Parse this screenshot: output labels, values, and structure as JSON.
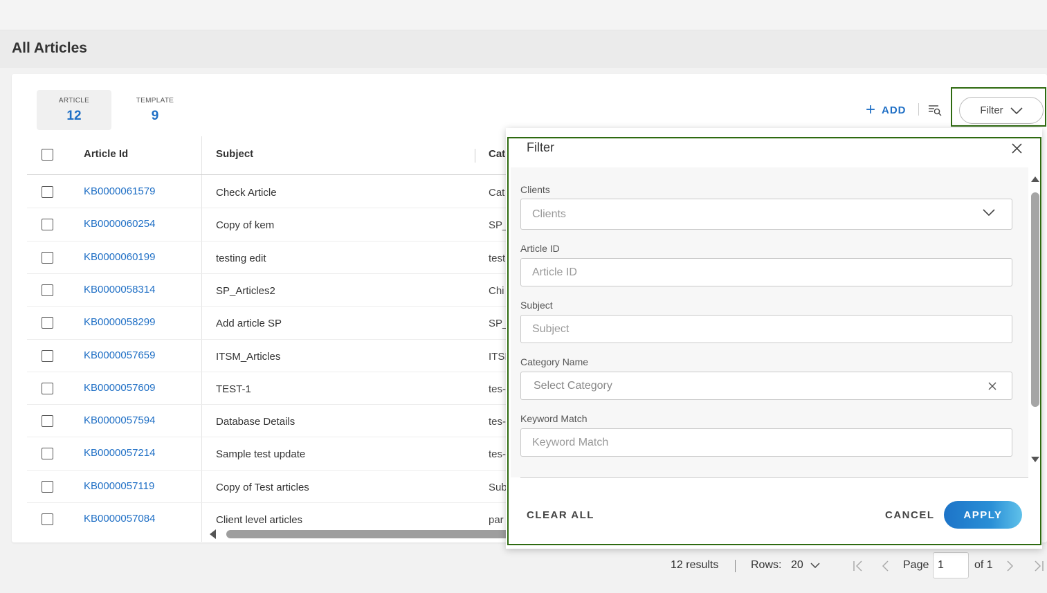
{
  "page": {
    "title": "All Articles"
  },
  "tabs": [
    {
      "label": "ARTICLE",
      "count": "12"
    },
    {
      "label": "TEMPLATE",
      "count": "9"
    }
  ],
  "toolbar": {
    "add_label": "ADD",
    "filter_label": "Filter"
  },
  "table": {
    "headers": {
      "article_id": "Article Id",
      "subject": "Subject",
      "category": "Cat"
    },
    "rows": [
      {
        "id": "KB0000061579",
        "subject": "Check Article",
        "category": "Cat"
      },
      {
        "id": "KB0000060254",
        "subject": "Copy of kem",
        "category": "SP_"
      },
      {
        "id": "KB0000060199",
        "subject": "testing edit",
        "category": "test"
      },
      {
        "id": "KB0000058314",
        "subject": "SP_Articles2",
        "category": "Chi"
      },
      {
        "id": "KB0000058299",
        "subject": "Add article SP",
        "category": "SP_"
      },
      {
        "id": "KB0000057659",
        "subject": "ITSM_Articles",
        "category": "ITSI"
      },
      {
        "id": "KB0000057609",
        "subject": "TEST-1",
        "category": "tes-"
      },
      {
        "id": "KB0000057594",
        "subject": "Database Details",
        "category": "tes-"
      },
      {
        "id": "KB0000057214",
        "subject": "Sample test update",
        "category": "tes-"
      },
      {
        "id": "KB0000057119",
        "subject": "Copy of Test articles",
        "category": "Sub"
      },
      {
        "id": "KB0000057084",
        "subject": "Client level articles",
        "category": "par"
      }
    ]
  },
  "pagination": {
    "results": "12 results",
    "rows_label": "Rows:",
    "rows_value": "20",
    "page_label": "Page",
    "page_value": "1",
    "of_label": "of 1"
  },
  "filter_panel": {
    "title": "Filter",
    "fields": {
      "clients": {
        "label": "Clients",
        "placeholder": "Clients"
      },
      "article_id": {
        "label": "Article ID",
        "placeholder": "Article ID"
      },
      "subject": {
        "label": "Subject",
        "placeholder": "Subject"
      },
      "category": {
        "label": "Category Name",
        "placeholder": "Select Category"
      },
      "keyword": {
        "label": "Keyword Match",
        "placeholder": "Keyword Match"
      }
    },
    "clear_all": "CLEAR ALL",
    "cancel": "CANCEL",
    "apply": "APPLY"
  },
  "colors": {
    "accent": "#1f6fc5",
    "highlight_outline": "#2e6a10"
  }
}
